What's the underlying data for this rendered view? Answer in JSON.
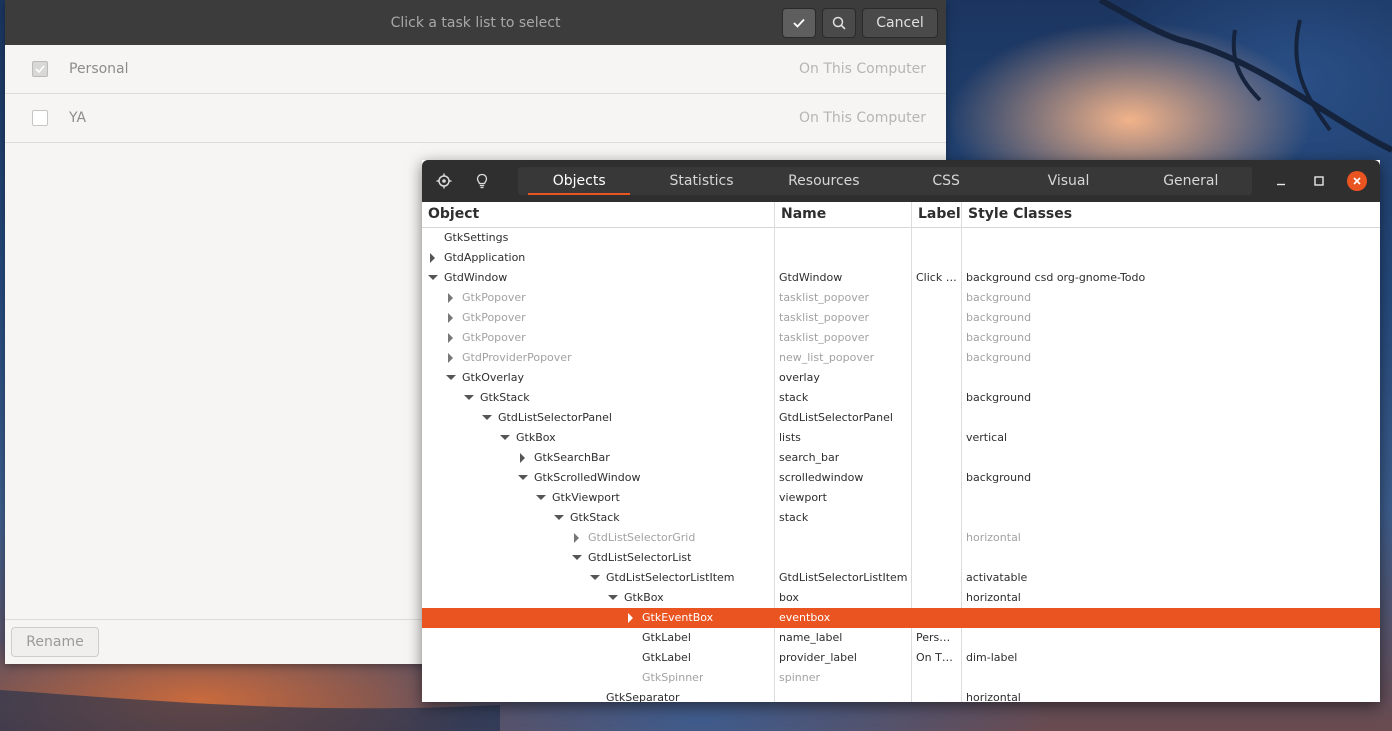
{
  "todo": {
    "title": "Click a task list to select",
    "confirm_icon": "checkmark-icon",
    "search_icon": "search-icon",
    "cancel_label": "Cancel",
    "rename_label": "Rename",
    "lists": [
      {
        "name": "Personal",
        "provider": "On This Computer",
        "checked": true
      },
      {
        "name": "YA",
        "provider": "On This Computer",
        "checked": false
      }
    ]
  },
  "inspector": {
    "tabs": [
      "Objects",
      "Statistics",
      "Resources",
      "CSS",
      "Visual",
      "General"
    ],
    "active_tab": "Objects",
    "columns": {
      "object": "Object",
      "name": "Name",
      "label": "Label",
      "style": "Style Classes"
    },
    "rows": [
      {
        "object": "GtkSettings",
        "depth": 0,
        "expander": "none",
        "name": "",
        "label": "",
        "style": "",
        "dim": false,
        "selected": false
      },
      {
        "object": "GtdApplication",
        "depth": 0,
        "expander": "closed",
        "name": "",
        "label": "",
        "style": "",
        "dim": false,
        "selected": false
      },
      {
        "object": "GtdWindow",
        "depth": 0,
        "expander": "open",
        "name": "GtdWindow",
        "label": "Click …",
        "style": "background csd org-gnome-Todo",
        "dim": false,
        "selected": false
      },
      {
        "object": "GtkPopover",
        "depth": 1,
        "expander": "closed",
        "name": "tasklist_popover",
        "label": "",
        "style": "background",
        "dim": true,
        "selected": false
      },
      {
        "object": "GtkPopover",
        "depth": 1,
        "expander": "closed",
        "name": "tasklist_popover",
        "label": "",
        "style": "background",
        "dim": true,
        "selected": false
      },
      {
        "object": "GtkPopover",
        "depth": 1,
        "expander": "closed",
        "name": "tasklist_popover",
        "label": "",
        "style": "background",
        "dim": true,
        "selected": false
      },
      {
        "object": "GtdProviderPopover",
        "depth": 1,
        "expander": "closed",
        "name": "new_list_popover",
        "label": "",
        "style": "background",
        "dim": true,
        "selected": false
      },
      {
        "object": "GtkOverlay",
        "depth": 1,
        "expander": "open",
        "name": "overlay",
        "label": "",
        "style": "",
        "dim": false,
        "selected": false
      },
      {
        "object": "GtkStack",
        "depth": 2,
        "expander": "open",
        "name": "stack",
        "label": "",
        "style": "background",
        "dim": false,
        "selected": false
      },
      {
        "object": "GtdListSelectorPanel",
        "depth": 3,
        "expander": "open",
        "name": "GtdListSelectorPanel",
        "label": "",
        "style": "",
        "dim": false,
        "selected": false
      },
      {
        "object": "GtkBox",
        "depth": 4,
        "expander": "open",
        "name": "lists",
        "label": "",
        "style": "vertical",
        "dim": false,
        "selected": false
      },
      {
        "object": "GtkSearchBar",
        "depth": 5,
        "expander": "closed",
        "name": "search_bar",
        "label": "",
        "style": "",
        "dim": false,
        "selected": false
      },
      {
        "object": "GtkScrolledWindow",
        "depth": 5,
        "expander": "open",
        "name": "scrolledwindow",
        "label": "",
        "style": "background",
        "dim": false,
        "selected": false
      },
      {
        "object": "GtkViewport",
        "depth": 6,
        "expander": "open",
        "name": "viewport",
        "label": "",
        "style": "",
        "dim": false,
        "selected": false
      },
      {
        "object": "GtkStack",
        "depth": 7,
        "expander": "open",
        "name": "stack",
        "label": "",
        "style": "",
        "dim": false,
        "selected": false
      },
      {
        "object": "GtdListSelectorGrid",
        "depth": 8,
        "expander": "closed",
        "name": "",
        "label": "",
        "style": "horizontal",
        "dim": true,
        "selected": false
      },
      {
        "object": "GtdListSelectorList",
        "depth": 8,
        "expander": "open",
        "name": "",
        "label": "",
        "style": "",
        "dim": false,
        "selected": false
      },
      {
        "object": "GtdListSelectorListItem",
        "depth": 9,
        "expander": "open",
        "name": "GtdListSelectorListItem",
        "label": "",
        "style": "activatable",
        "dim": false,
        "selected": false
      },
      {
        "object": "GtkBox",
        "depth": 10,
        "expander": "open",
        "name": "box",
        "label": "",
        "style": "horizontal",
        "dim": false,
        "selected": false
      },
      {
        "object": "GtkEventBox",
        "depth": 11,
        "expander": "closed",
        "name": "eventbox",
        "label": "",
        "style": "",
        "dim": false,
        "selected": true
      },
      {
        "object": "GtkLabel",
        "depth": 11,
        "expander": "none",
        "name": "name_label",
        "label": "Pers…",
        "style": "",
        "dim": false,
        "selected": false
      },
      {
        "object": "GtkLabel",
        "depth": 11,
        "expander": "none",
        "name": "provider_label",
        "label": "On T…",
        "style": "dim-label",
        "dim": false,
        "selected": false
      },
      {
        "object": "GtkSpinner",
        "depth": 11,
        "expander": "none",
        "name": "spinner",
        "label": "",
        "style": "",
        "dim": true,
        "selected": false
      },
      {
        "object": "GtkSeparator",
        "depth": 9,
        "expander": "none",
        "name": "",
        "label": "",
        "style": "horizontal",
        "dim": false,
        "selected": false
      }
    ]
  },
  "colors": {
    "accent": "#e95420",
    "header_dark": "#2f2f2f"
  }
}
